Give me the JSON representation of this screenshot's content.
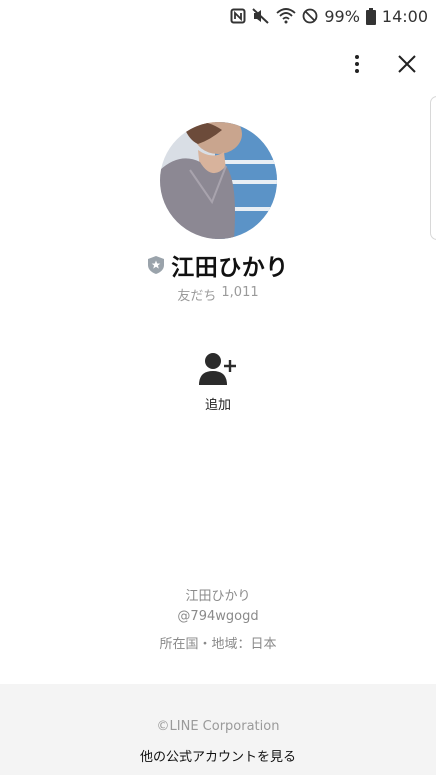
{
  "status_bar": {
    "battery_percent": "99%",
    "time": "14:00",
    "icons": [
      "nfc-icon",
      "mute-icon",
      "wifi-icon",
      "blocked-icon",
      "battery-icon"
    ]
  },
  "profile": {
    "name": "江田ひかり",
    "friends_label": "友だち",
    "friends_count": "1,011",
    "badge_icon": "official-shield-icon"
  },
  "actions": {
    "add_label": "追加"
  },
  "info": {
    "name": "江田ひかり",
    "line_id": "@794wgogd",
    "location": "所在国・地域：日本"
  },
  "footer": {
    "copyright": "©LINE Corporation",
    "other_accounts_link": "他の公式アカウントを見る"
  },
  "colors": {
    "background": "#ffffff",
    "footer_background": "#f4f4f4",
    "muted_text": "#9a9a9a",
    "icon_dark": "#2b2b2b"
  }
}
